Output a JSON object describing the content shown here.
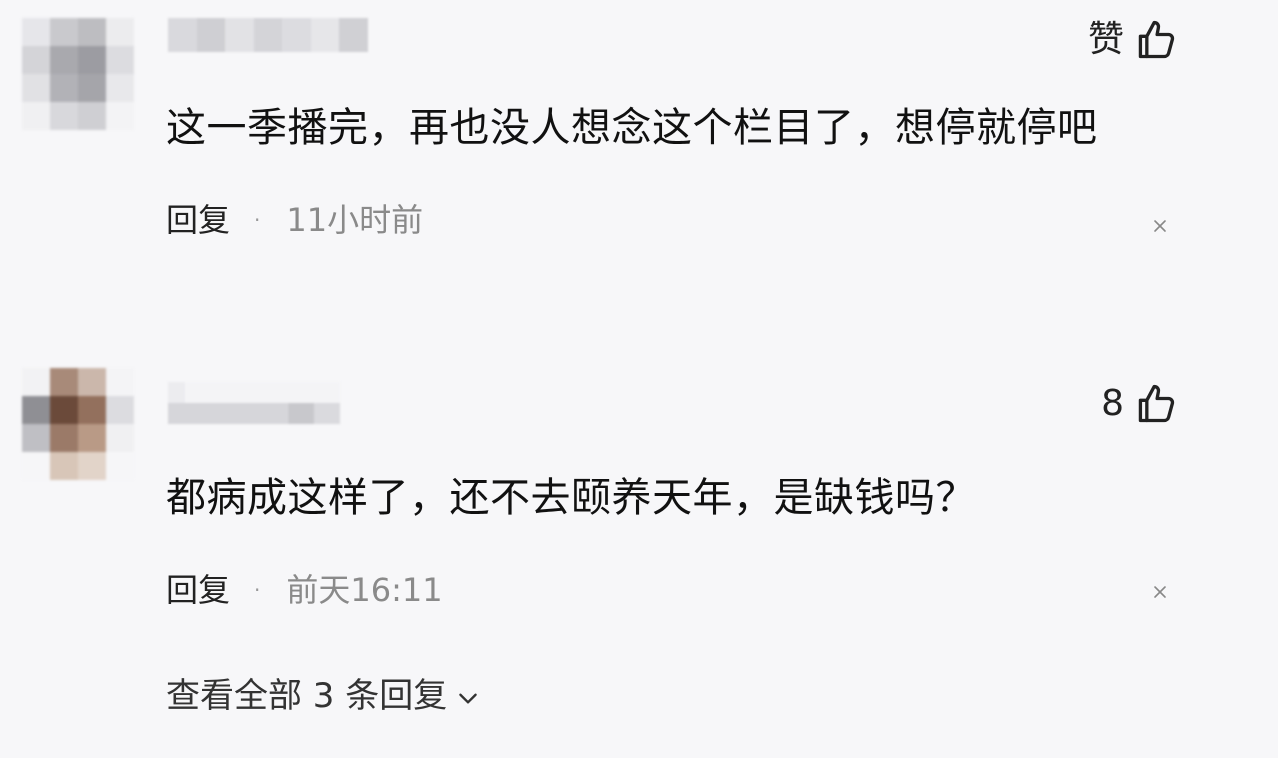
{
  "comments": [
    {
      "like_label": "赞",
      "body": "这一季播完，再也没人想念这个栏目了，想停就停吧",
      "reply_label": "回复",
      "separator": "·",
      "time": "11小时前"
    },
    {
      "like_label": "8",
      "body": "都病成这样了，还不去颐养天年，是缺钱吗？",
      "reply_label": "回复",
      "separator": "·",
      "time": "前天16:11",
      "view_all_replies": "查看全部 3 条回复"
    }
  ],
  "icons": {
    "like": "thumb-up-icon",
    "dismiss": "close-icon",
    "expand": "chevron-down-icon"
  },
  "colors": {
    "background": "#f7f7f9",
    "text": "#111111",
    "muted": "#8a8a8a"
  }
}
